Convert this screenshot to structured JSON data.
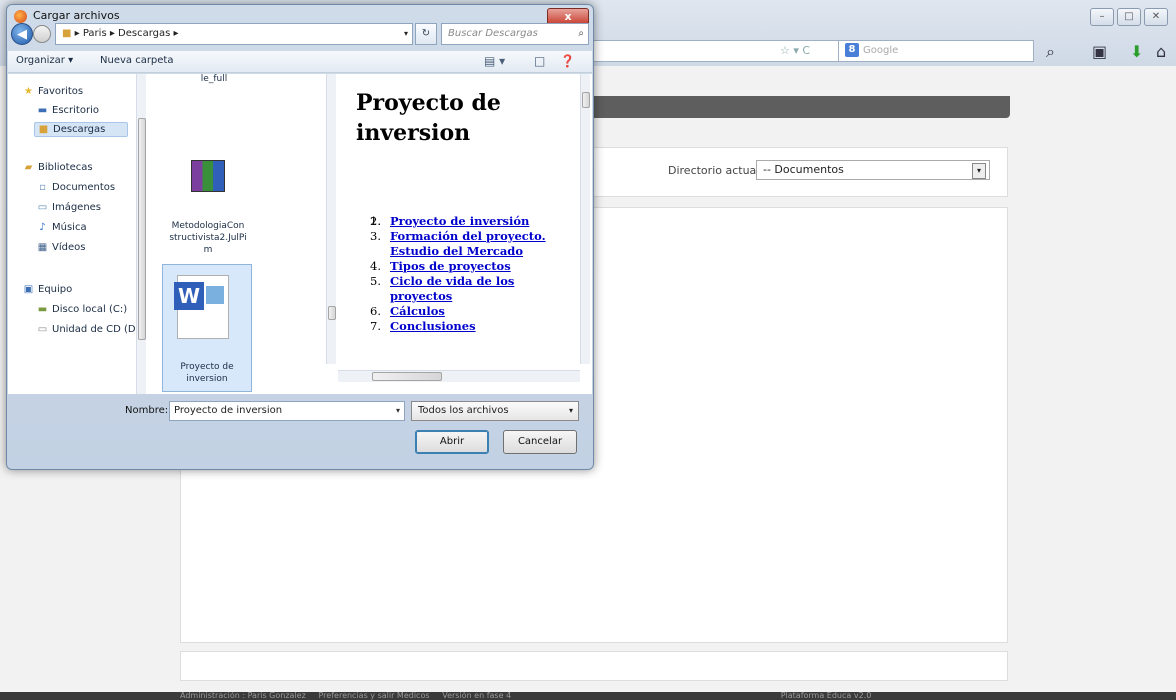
{
  "browser": {
    "search_placeholder": "Google",
    "directory_label": "Directorio actual:",
    "directory_value": "-- Documentos",
    "status_text": "Administración : Paris Gonzalez     Preferencias y salir Medicos     Versión en fase 4                                                                                                          Plataforma Educa v2.0"
  },
  "dialog": {
    "title": "Cargar archivos",
    "close_label": "x",
    "breadcrumb": "▸ Paris ▸ Descargas ▸",
    "search_placeholder": "Buscar Descargas",
    "toolbar": {
      "organize": "Organizar ▾",
      "new_folder": "Nueva carpeta"
    },
    "nav": {
      "favorites": "Favoritos",
      "desktop": "Escritorio",
      "downloads": "Descargas",
      "libraries": "Bibliotecas",
      "documents": "Documentos",
      "images": "Imágenes",
      "music": "Música",
      "videos": "Vídeos",
      "computer": "Equipo",
      "local_disk": "Disco local (C:)",
      "cd_drive": "Unidad de CD (D"
    },
    "files": {
      "top_partial": "le_full",
      "rar_name_1": "MetodologiaCon",
      "rar_name_2": "structivista2.JulPi",
      "rar_name_3": "m",
      "doc_name_1": "Proyecto de",
      "doc_name_2": "inversion"
    },
    "preview": {
      "title_1": "Proyecto de",
      "title_2": "inversion",
      "items": [
        {
          "n": "1.",
          "text": ""
        },
        {
          "n": "2.",
          "text": "Proyecto de inversión"
        },
        {
          "n": "3.",
          "text": "Formación del proyecto. Estudio del Mercado"
        },
        {
          "n": "4.",
          "text": "Tipos de proyectos"
        },
        {
          "n": "5.",
          "text": "Ciclo de vida de los proyectos"
        },
        {
          "n": "6.",
          "text": "Cálculos"
        },
        {
          "n": "7.",
          "text": "Conclusiones"
        }
      ]
    },
    "filename_label": "Nombre:",
    "filename_value": "Proyecto de inversion",
    "filetype_value": "Todos los archivos",
    "open_label": "Abrir",
    "cancel_label": "Cancelar"
  }
}
